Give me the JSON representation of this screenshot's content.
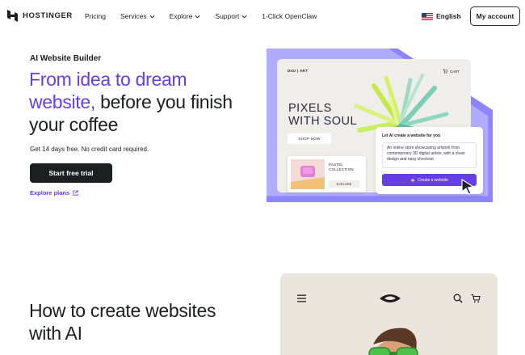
{
  "header": {
    "logo_text": "HOSTINGER",
    "nav": [
      {
        "label": "Pricing",
        "dropdown": false
      },
      {
        "label": "Services",
        "dropdown": true
      },
      {
        "label": "Explore",
        "dropdown": true
      },
      {
        "label": "Support",
        "dropdown": true
      },
      {
        "label": "1-Click OpenClaw",
        "dropdown": false
      }
    ],
    "language": "English",
    "account_button": "My account"
  },
  "hero": {
    "eyebrow": "AI Website Builder",
    "headline_accent": "From idea to dream website,",
    "headline_rest": " before you finish your coffee",
    "subtext": "Get 14 days free. No credit card required.",
    "cta_label": "Start free trial",
    "explore_label": "Explore plans"
  },
  "illustration": {
    "brand": "DIGI | ART",
    "cart_label": "CART",
    "title_line1": "PIXELS",
    "title_line2": "WITH SOUL",
    "shop_button": "SHOP NOW",
    "mini_label_line1": "PASTEL",
    "mini_label_line2": "COLLECTION",
    "mini_button": "EXPLORE",
    "ai_title": "Let AI create a website for you",
    "ai_prompt": "An online store showcasing artwork from contemporary 3D digital artists, with a clean design and easy checkout.",
    "ai_button": "Create a website"
  },
  "section2": {
    "title": "How to create websites with AI"
  },
  "colors": {
    "accent": "#673de6",
    "dark": "#1d1e20",
    "illustration_purple": "#8c85ff"
  },
  "icons": [
    "hostinger-logo-icon",
    "chevron-down-icon",
    "us-flag-icon",
    "external-link-icon",
    "cart-icon",
    "sparkle-icon",
    "cursor-icon",
    "menu-icon",
    "search-icon"
  ]
}
